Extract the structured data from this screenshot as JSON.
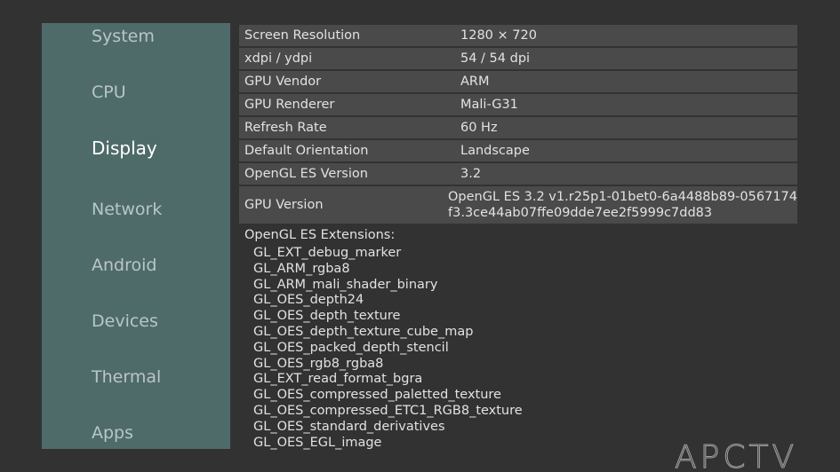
{
  "sidebar": {
    "items": [
      {
        "label": "System"
      },
      {
        "label": "CPU"
      },
      {
        "label": "Display"
      },
      {
        "label": "Network"
      },
      {
        "label": "Android"
      },
      {
        "label": "Devices"
      },
      {
        "label": "Thermal"
      },
      {
        "label": "Apps"
      }
    ],
    "active": "Display"
  },
  "display_info": {
    "rows": [
      {
        "key": "Screen Resolution",
        "value": "1280 × 720"
      },
      {
        "key": "xdpi / ydpi",
        "value": "54 / 54 dpi"
      },
      {
        "key": "GPU Vendor",
        "value": "ARM"
      },
      {
        "key": "GPU Renderer",
        "value": "Mali-G31"
      },
      {
        "key": "Refresh Rate",
        "value": "60 Hz"
      },
      {
        "key": "Default Orientation",
        "value": "Landscape"
      },
      {
        "key": "OpenGL ES Version",
        "value": "3.2"
      },
      {
        "key": "GPU Version",
        "value_line1": "OpenGL ES 3.2 v1.r25p1-01bet0-6a4488b89-0567174",
        "value_line2": "f3.3ce44ab07ffe09dde7ee2f5999c7dd83"
      }
    ]
  },
  "extensions": {
    "title": "OpenGL ES Extensions:",
    "items": [
      "GL_EXT_debug_marker",
      "GL_ARM_rgba8",
      "GL_ARM_mali_shader_binary",
      "GL_OES_depth24",
      "GL_OES_depth_texture",
      "GL_OES_depth_texture_cube_map",
      "GL_OES_packed_depth_stencil",
      "GL_OES_rgb8_rgba8",
      "GL_EXT_read_format_bgra",
      "GL_OES_compressed_paletted_texture",
      "GL_OES_compressed_ETC1_RGB8_texture",
      "GL_OES_standard_derivatives",
      "GL_OES_EGL_image"
    ]
  },
  "watermark": {
    "text": "APCTV"
  },
  "colors": {
    "background": "#323232",
    "sidebar": "#4e6b6a",
    "row_shade": "#4a4a4a",
    "text": "#e2e2e2",
    "nav_text": "#b9c6c5",
    "nav_active": "#ffffff"
  }
}
